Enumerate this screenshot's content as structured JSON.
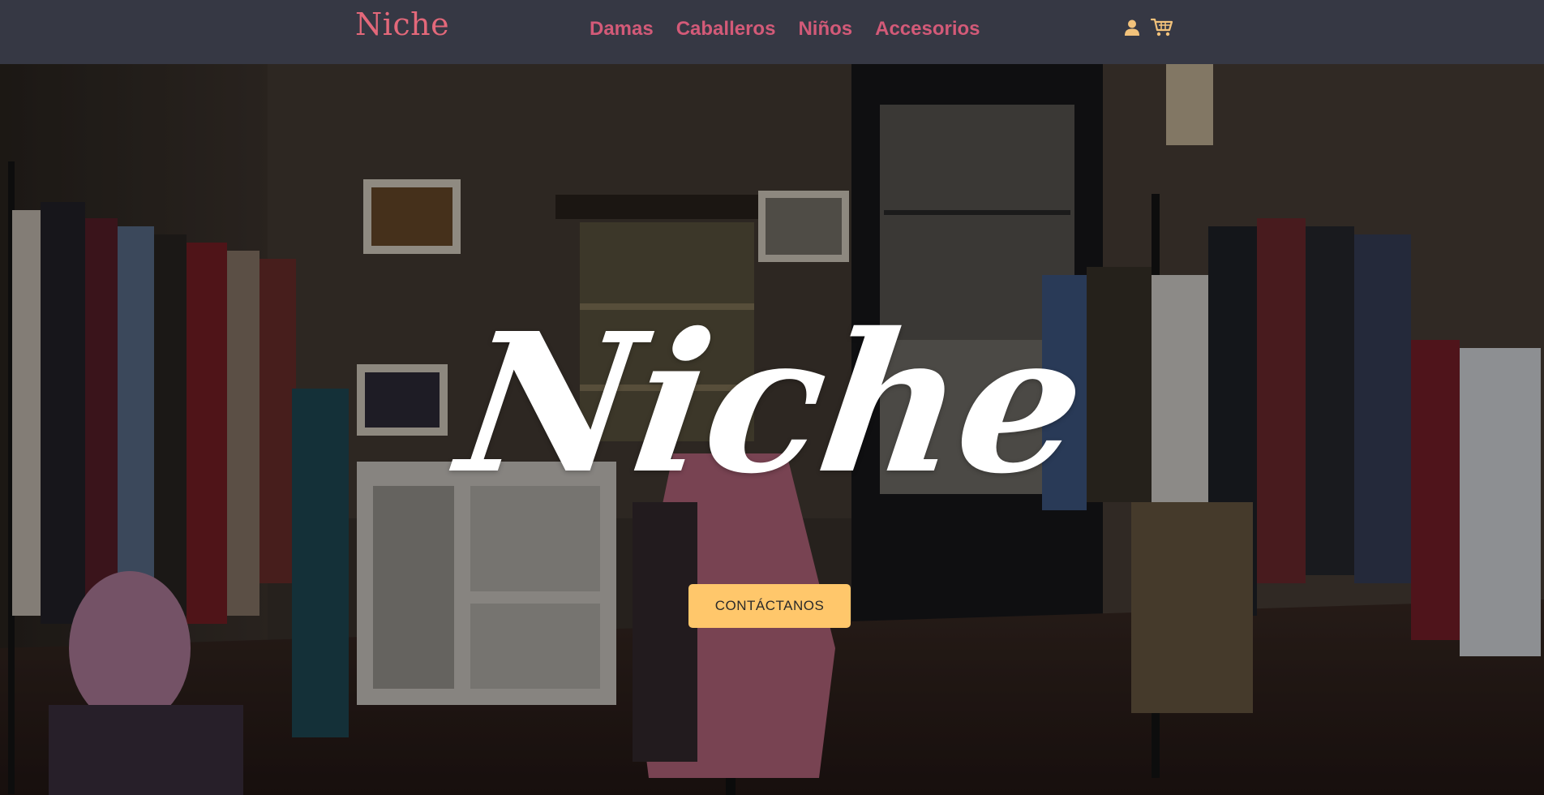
{
  "navbar": {
    "brand": "Niche",
    "links": [
      "Damas",
      "Caballeros",
      "Niños",
      "Accesorios"
    ],
    "icons": [
      "user-icon",
      "cart-icon"
    ],
    "accent_color": "#d35a78",
    "icon_color": "#f2c27b"
  },
  "hero": {
    "title": "Niche",
    "cta_label": "CONTÁCTANOS",
    "cta_color": "#ffc76b"
  }
}
